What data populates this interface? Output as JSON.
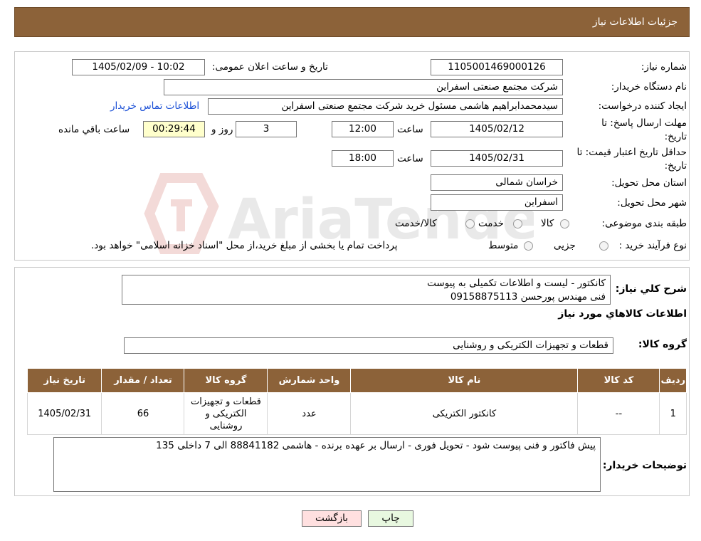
{
  "header": {
    "title": "جزئیات اطلاعات نیاز"
  },
  "form": {
    "need_number_label": "شماره نیاز:",
    "need_number": "1105001469000126",
    "announce_label": "تاریخ و ساعت اعلان عمومی:",
    "announce_value": "1405/02/09 - 10:02",
    "buyer_org_label": "نام دستگاه خریدار:",
    "buyer_org": "شرکت مجتمع صنعتی اسفراین",
    "requester_label": "ایجاد کننده درخواست:",
    "requester": "سیدمحمدابراهیم هاشمی مسئول خرید شرکت مجتمع صنعتی اسفراین",
    "contact_link": "اطلاعات تماس خریدار",
    "deadline_label_line1": "مهلت ارسال پاسخ: تا",
    "deadline_label_line2": "تاریخ:",
    "deadline_date": "1405/02/12",
    "time_label": "ساعت",
    "deadline_time": "12:00",
    "days_value": "3",
    "days_label": "روز و",
    "remaining_time": "00:29:44",
    "remaining_label": "ساعت باقي مانده",
    "validity_label_line1": "حداقل تاریخ اعتبار قیمت: تا",
    "validity_label_line2": "تاریخ:",
    "validity_date": "1405/02/31",
    "validity_time": "18:00",
    "province_label": "استان محل تحویل:",
    "province": "خراسان شمالی",
    "city_label": "شهر محل تحویل:",
    "city": "اسفراین",
    "category_label": "طبقه بندی موضوعی:",
    "category_options": [
      "کالا",
      "خدمت",
      "کالا/خدمت"
    ],
    "process_label": "نوع فرآیند خرید :",
    "process_options": [
      "جزیی",
      "متوسط"
    ],
    "process_note": "پرداخت تمام یا بخشی از مبلغ خرید،از محل \"اسناد خزانه اسلامی\" خواهد بود."
  },
  "summary": {
    "desc_label": "شرح کلي نياز:",
    "desc_line1": "کانکتور - لیست و اطلاعات تکمیلی به پیوست",
    "desc_line2": "فنی مهندس پورحسن 09158875113",
    "goods_info_title": "اطلاعات کالاهاي مورد نياز",
    "goods_group_label": "گروه کالا:",
    "goods_group": "قطعات و تجهیزات الکتریکی و روشنایی"
  },
  "table": {
    "headers": [
      "رديف",
      "کد کالا",
      "نام کالا",
      "واحد شمارش",
      "گروه کالا",
      "تعداد / مقدار",
      "تاریخ نیاز"
    ],
    "rows": [
      [
        "1",
        "--",
        "کانکتور الکتریکی",
        "عدد",
        "قطعات و تجهیزات الکتریکی و روشنایی",
        "66",
        "1405/02/31"
      ]
    ]
  },
  "buyer_notes": {
    "label": "توضیحات خریدار:",
    "text": "پیش فاکتور و فنی پیوست شود - تحویل فوری - ارسال بر عهده برنده - هاشمی 88841182 الی 7 داخلی 135"
  },
  "buttons": {
    "print": "چاپ",
    "back": "بازگشت"
  },
  "watermark": {
    "text": "AriaTender.neT"
  },
  "colors": {
    "header_bg": "#8c6239",
    "link": "#1a4fd6",
    "yellow_box": "#ffffcc",
    "back_btn": "#ffe0e0",
    "print_btn": "#e8f8e0"
  }
}
